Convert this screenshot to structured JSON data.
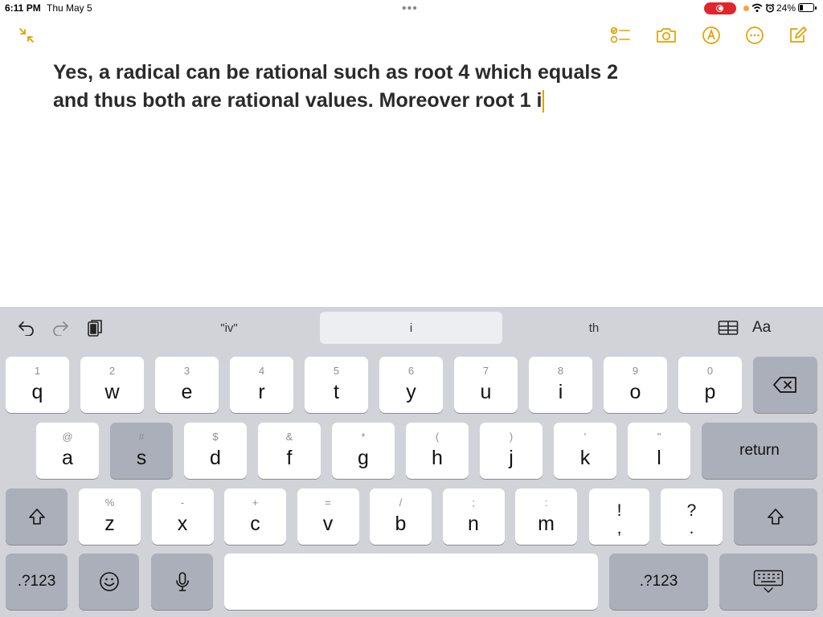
{
  "status_bar": {
    "time": "6:11 PM",
    "date": "Thu May 5",
    "multitask_dots": "•••",
    "status_icons": "📶 ⏰",
    "battery_percent": "24%",
    "battery_level": 0.24
  },
  "toolbar": {
    "icons": [
      "collapse-icon",
      "checklist-icon",
      "camera-icon",
      "markup-pen-icon",
      "more-icon",
      "compose-icon"
    ],
    "accent_color": "#e0a100"
  },
  "note": {
    "line1": "Yes, a radical can be rational such as root 4 which equals 2",
    "line2": "and thus both are rational values. Moreover root 1 i"
  },
  "shortcut_bar": {
    "suggestion_left": "\"iv\"",
    "suggestion_center": "i",
    "suggestion_right": "th",
    "format_label": "Aa"
  },
  "keyboard": {
    "row1": [
      {
        "sec": "1",
        "pri": "q"
      },
      {
        "sec": "2",
        "pri": "w"
      },
      {
        "sec": "3",
        "pri": "e"
      },
      {
        "sec": "4",
        "pri": "r"
      },
      {
        "sec": "5",
        "pri": "t"
      },
      {
        "sec": "6",
        "pri": "y"
      },
      {
        "sec": "7",
        "pri": "u"
      },
      {
        "sec": "8",
        "pri": "i"
      },
      {
        "sec": "9",
        "pri": "o"
      },
      {
        "sec": "0",
        "pri": "p"
      }
    ],
    "row2": [
      {
        "sec": "@",
        "pri": "a"
      },
      {
        "sec": "#",
        "pri": "s"
      },
      {
        "sec": "$",
        "pri": "d"
      },
      {
        "sec": "&",
        "pri": "f"
      },
      {
        "sec": "*",
        "pri": "g"
      },
      {
        "sec": "(",
        "pri": "h"
      },
      {
        "sec": ")",
        "pri": "j"
      },
      {
        "sec": "'",
        "pri": "k"
      },
      {
        "sec": "\"",
        "pri": "l"
      }
    ],
    "row3": [
      {
        "sec": "%",
        "pri": "z"
      },
      {
        "sec": "-",
        "pri": "x"
      },
      {
        "sec": "+",
        "pri": "c"
      },
      {
        "sec": "=",
        "pri": "v"
      },
      {
        "sec": "/",
        "pri": "b"
      },
      {
        "sec": ";",
        "pri": "n"
      },
      {
        "sec": ":",
        "pri": "m"
      }
    ],
    "punct1": {
      "top": "!",
      "bottom": ","
    },
    "punct2": {
      "top": "?",
      "bottom": "."
    },
    "return_label": "return",
    "numbers_label": ".?123",
    "pressed_key": "s"
  }
}
